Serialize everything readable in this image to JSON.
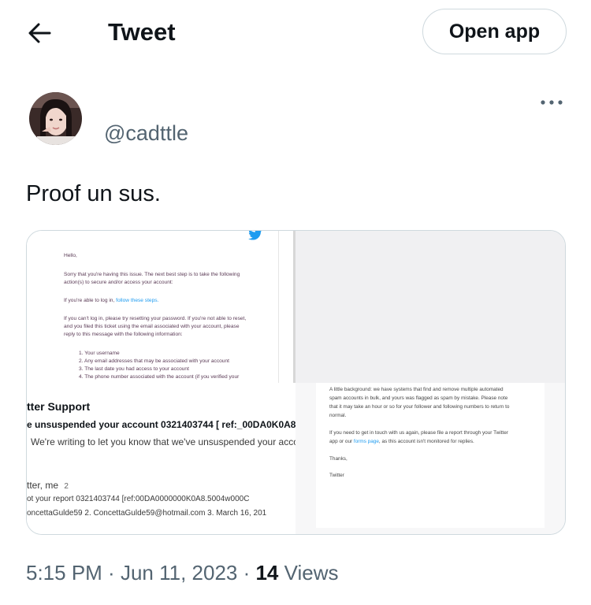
{
  "header": {
    "title": "Tweet",
    "open_app_label": "Open app"
  },
  "author": {
    "handle": "@cadttle"
  },
  "tweet": {
    "text": "Proof un sus."
  },
  "media": {
    "top_left": {
      "lines": [
        "Hello,",
        "Sorry that you're having this issue. The next best step is to take the following",
        "action(s) to secure and/or access your account:",
        "If you're able to log in,",
        "follow these steps.",
        "If you can't log in, please try resetting your password. If you're not able to reset,",
        "and you filed this ticket using the email associated with your account, please",
        "reply to this message with the following information:",
        "1. Your username",
        "2. Any email addresses that may be associated with your account",
        "3. The last date you had access to your account",
        "4. The phone number associated with the account (if you verified your"
      ]
    },
    "bottom_left": {
      "title": "tter Support",
      "subject": "e unsuspended your account 0321403744   [ ref:_00DA0K0A8",
      "body": "We're writing to let you know that we've unsuspended your accoun",
      "participants": "tter, me",
      "count": "2",
      "report": "ot your report 0321403744 [ref:00DA0000000K0A8.5004w000C",
      "details": "oncettaGulde59 2. ConcettaGulde59@hotmail.com 3. March 16, 201"
    },
    "bottom_right": {
      "lines": [
        "A little background: we have systems that find and remove multiple automated",
        "spam accounts in bulk, and yours was flagged as spam by mistake. Please note",
        "that it may take an hour or so for your follower and following numbers to return to",
        "normal.",
        "If you need to get in touch with us again, please file a report through your Twitter",
        "app or our",
        "forms page",
        ", as this account isn't monitored for replies.",
        "Thanks,",
        "Twitter"
      ]
    }
  },
  "footer": {
    "time": "5:15 PM",
    "sep1": " · ",
    "date": "Jun 11, 2023",
    "sep2": " · ",
    "views_count": "14",
    "views_label": " Views"
  },
  "colors": {
    "text": "#0f1419",
    "secondary": "#536471",
    "border": "#cfd9de",
    "link": "#1d9bf0"
  }
}
